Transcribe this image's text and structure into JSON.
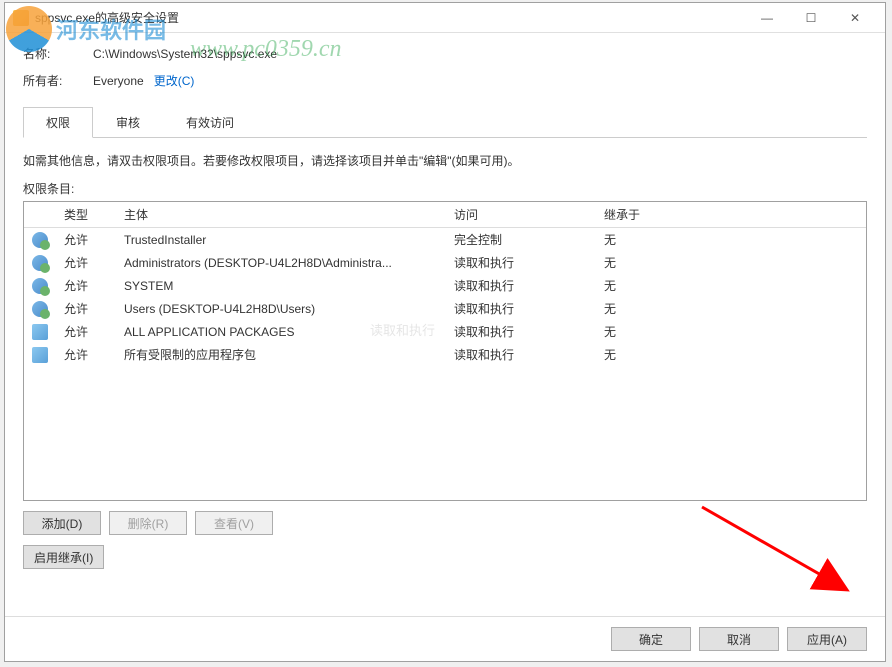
{
  "window": {
    "title": "sppsvc.exe的高级安全设置"
  },
  "fields": {
    "name_label": "名称:",
    "name_value": "C:\\Windows\\System32\\sppsvc.exe",
    "owner_label": "所有者:",
    "owner_value": "Everyone",
    "change_link": "更改(C)"
  },
  "tabs": {
    "permissions": "权限",
    "audit": "审核",
    "effective": "有效访问"
  },
  "info_text": "如需其他信息，请双击权限项目。若要修改权限项目，请选择该项目并单击\"编辑\"(如果可用)。",
  "entries_label": "权限条目:",
  "columns": {
    "type": "类型",
    "principal": "主体",
    "access": "访问",
    "inherited_from": "继承于"
  },
  "rows": [
    {
      "icon": "users",
      "type": "允许",
      "principal": "TrustedInstaller",
      "access": "完全控制",
      "inherited": "无"
    },
    {
      "icon": "users",
      "type": "允许",
      "principal": "Administrators (DESKTOP-U4L2H8D\\Administra...",
      "access": "读取和执行",
      "inherited": "无"
    },
    {
      "icon": "users",
      "type": "允许",
      "principal": "SYSTEM",
      "access": "读取和执行",
      "inherited": "无"
    },
    {
      "icon": "users",
      "type": "允许",
      "principal": "Users (DESKTOP-U4L2H8D\\Users)",
      "access": "读取和执行",
      "inherited": "无"
    },
    {
      "icon": "pkg",
      "type": "允许",
      "principal": "ALL APPLICATION PACKAGES",
      "access": "读取和执行",
      "inherited": "无"
    },
    {
      "icon": "pkg",
      "type": "允许",
      "principal": "所有受限制的应用程序包",
      "access": "读取和执行",
      "inherited": "无"
    }
  ],
  "buttons": {
    "add": "添加(D)",
    "delete": "删除(R)",
    "view": "查看(V)",
    "enable_inherit": "启用继承(I)",
    "ok": "确定",
    "cancel": "取消",
    "apply": "应用(A)"
  },
  "watermark": {
    "site_name": "河东软件园",
    "url": "www.pc0359.cn",
    "center": "读取和执行"
  }
}
